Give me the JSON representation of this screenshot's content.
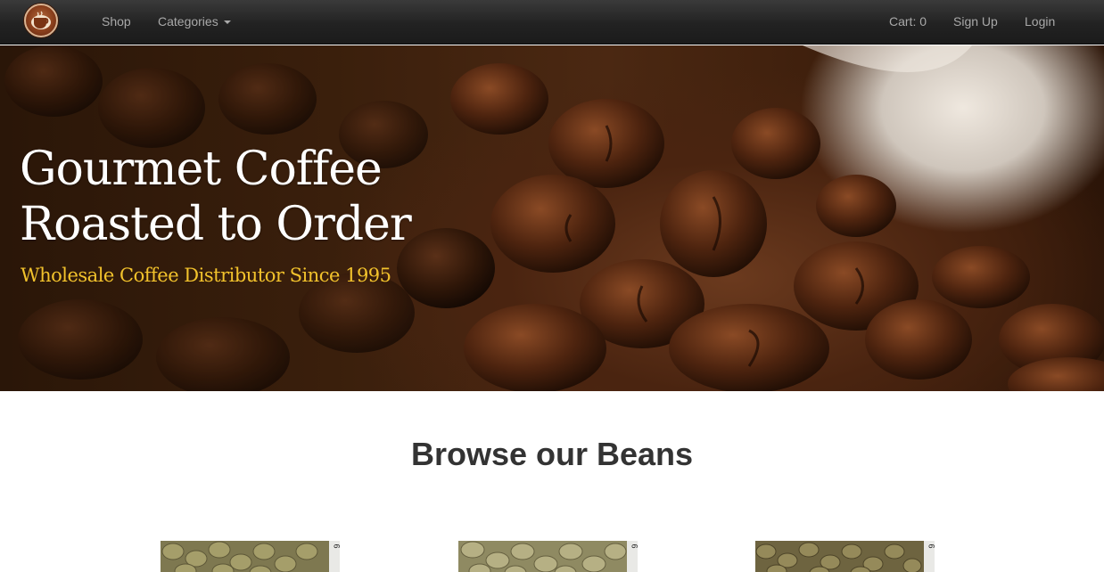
{
  "navbar": {
    "logo": "coffee-cup-logo",
    "links": {
      "shop": "Shop",
      "categories": "Categories",
      "cart": "Cart: 0",
      "signup": "Sign Up",
      "login": "Login"
    }
  },
  "hero": {
    "title_line1": "Gourmet Coffee",
    "title_line2": "Roasted to Order",
    "subtitle": "Wholesale Coffee Distributor Since 1995",
    "colors": {
      "title": "#ffffff",
      "subtitle": "#f2c22c"
    }
  },
  "main": {
    "section_title": "Browse our Beans",
    "products": [
      {
        "image": "green-coffee-beans",
        "ruler_mark": "6"
      },
      {
        "image": "green-coffee-beans",
        "ruler_mark": "6"
      },
      {
        "image": "green-coffee-beans",
        "ruler_mark": "6"
      }
    ]
  }
}
